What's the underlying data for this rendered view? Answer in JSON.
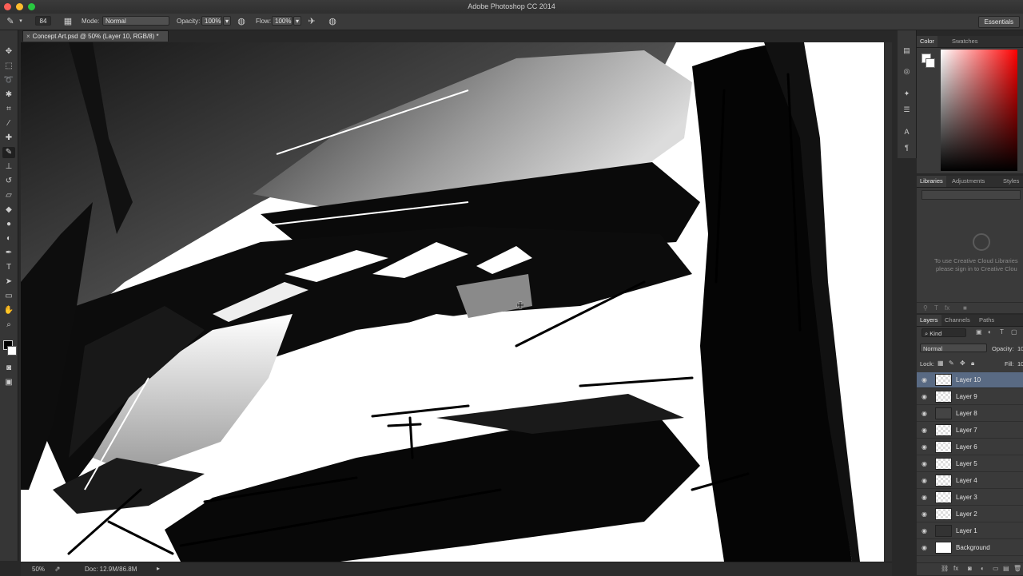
{
  "window": {
    "title": "Adobe Photoshop CC 2014"
  },
  "options_bar": {
    "brush_size": "84",
    "mode_label": "Mode:",
    "mode_value": "Normal",
    "opacity_label": "Opacity:",
    "opacity_value": "100%",
    "flow_label": "Flow:",
    "flow_value": "100%",
    "workspace": "Essentials"
  },
  "document": {
    "tab_title": "Concept Art.psd @ 50% (Layer 10, RGB/8) *"
  },
  "status_bar": {
    "zoom": "50%",
    "doc_size": "Doc: 12.9M/86.8M"
  },
  "color_panel": {
    "tabs": [
      "Color",
      "Swatches"
    ],
    "accent": "#ff0000"
  },
  "libraries_panel": {
    "tabs": [
      "Libraries",
      "Adjustments",
      "Styles"
    ],
    "message_line1": "To use Creative Cloud Libraries",
    "message_line2": "please sign in to Creative Clou"
  },
  "layers_panel": {
    "tabs": [
      "Layers",
      "Channels",
      "Paths"
    ],
    "filter_kind": "Kind",
    "blend_mode": "Normal",
    "opacity_label": "Opacity:",
    "opacity_value": "10",
    "lock_label": "Lock:",
    "fill_label": "Fill:",
    "fill_value": "10",
    "layers": [
      "Layer 10",
      "Layer 9",
      "Layer 8",
      "Layer 7",
      "Layer 6",
      "Layer 5",
      "Layer 4",
      "Layer 3",
      "Layer 2",
      "Layer 1",
      "Background"
    ],
    "selected": "Layer 10",
    "selection_color": "#596a83"
  },
  "tools": [
    "move-icon",
    "marquee-icon",
    "lasso-icon",
    "quick-select-icon",
    "crop-icon",
    "eyedropper-icon",
    "healing-brush-icon",
    "brush-icon",
    "clone-stamp-icon",
    "history-brush-icon",
    "eraser-icon",
    "paint-bucket-icon",
    "blur-icon",
    "dodge-icon",
    "pen-icon",
    "type-icon",
    "path-select-icon",
    "shape-icon",
    "hand-icon",
    "zoom-icon"
  ]
}
